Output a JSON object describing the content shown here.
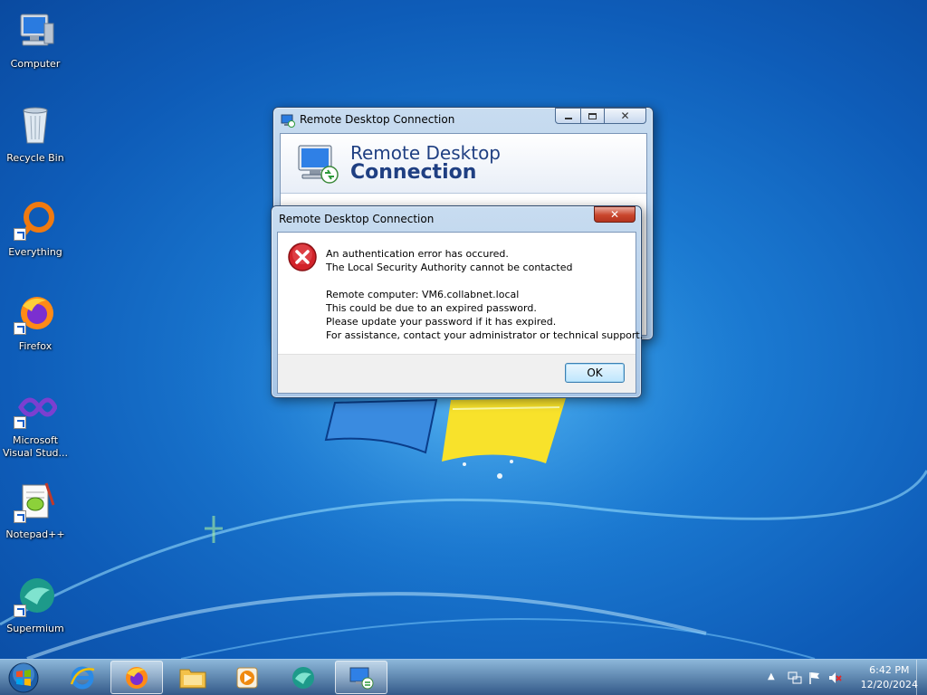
{
  "desktop": {
    "icons": [
      {
        "label": "Computer"
      },
      {
        "label": "Recycle Bin"
      },
      {
        "label": "Everything"
      },
      {
        "label": "Firefox"
      },
      {
        "label": "Microsoft Visual Stud..."
      },
      {
        "label": "Notepad++"
      },
      {
        "label": "Supermium"
      }
    ]
  },
  "main_window": {
    "title": "Remote Desktop Connection",
    "banner_line1": "Remote Desktop",
    "banner_line2": "Connection"
  },
  "error_dialog": {
    "title": "Remote Desktop Connection",
    "lines": [
      "An authentication error has occured.",
      "The Local Security Authority cannot be contacted",
      "",
      "Remote computer: VM6.collabnet.local",
      "This could be due to an expired password.",
      "Please update your password if it has expired.",
      "For assistance, contact your administrator or technical support."
    ],
    "ok_label": "OK"
  },
  "taskbar": {
    "apps": [
      {
        "icon": "internet-explorer-icon"
      },
      {
        "icon": "firefox-icon"
      },
      {
        "icon": "file-explorer-icon"
      },
      {
        "icon": "media-player-icon"
      },
      {
        "icon": "supermium-icon"
      },
      {
        "icon": "remote-desktop-icon"
      }
    ],
    "clock_time": "6:42 PM",
    "clock_date": "12/20/2024"
  },
  "colors": {
    "accent_title": "#1f3f82",
    "desktop_blue": "#1a78d0",
    "error_red": "#c8262a"
  }
}
